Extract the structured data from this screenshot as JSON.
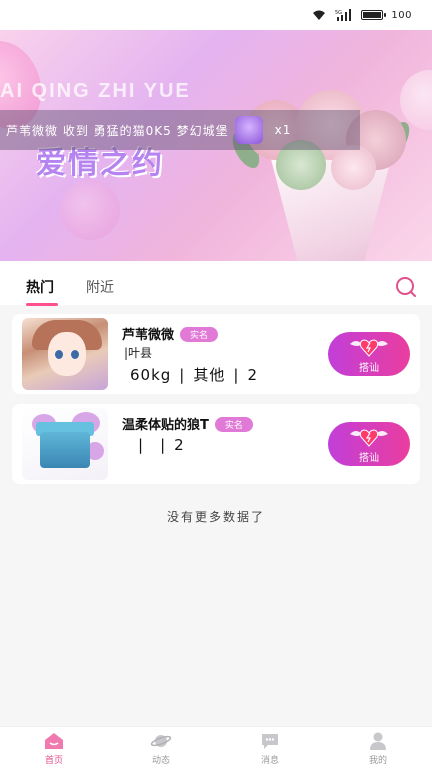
{
  "status_bar": {
    "battery": "100",
    "battery_level": 1.0,
    "signal_label": "5G"
  },
  "banner": {
    "subtitle": "AI QING ZHI YUE",
    "title": "爱情之约",
    "notice": {
      "text": "芦苇微微 收到 勇猛的猫0K5 梦幻城堡",
      "count": "x1"
    }
  },
  "tabs": [
    {
      "label": "热门",
      "active": true
    },
    {
      "label": "附近",
      "active": false
    }
  ],
  "users": [
    {
      "name": "芦苇微微",
      "badge": "实名",
      "location": "|叶县",
      "weight": "60kg",
      "occupation": "其他",
      "num": "2",
      "button": "搭讪"
    },
    {
      "name": "温柔体贴的狼T",
      "badge": "实名",
      "location": "",
      "weight": "",
      "occupation": "",
      "num": "2",
      "button": "搭讪"
    }
  ],
  "no_more_text": "没有更多数据了",
  "bottom_nav": [
    {
      "label": "首页",
      "icon": "home-icon",
      "active": true
    },
    {
      "label": "动态",
      "icon": "planet-icon",
      "active": false
    },
    {
      "label": "消息",
      "icon": "chat-bubble-icon",
      "active": false
    },
    {
      "label": "我的",
      "icon": "person-icon",
      "active": false
    }
  ],
  "colors": {
    "accent": "#ff4f8e",
    "button_start": "#c13fd9",
    "button_end": "#ea3d9e",
    "badge": "#e07ad6"
  }
}
